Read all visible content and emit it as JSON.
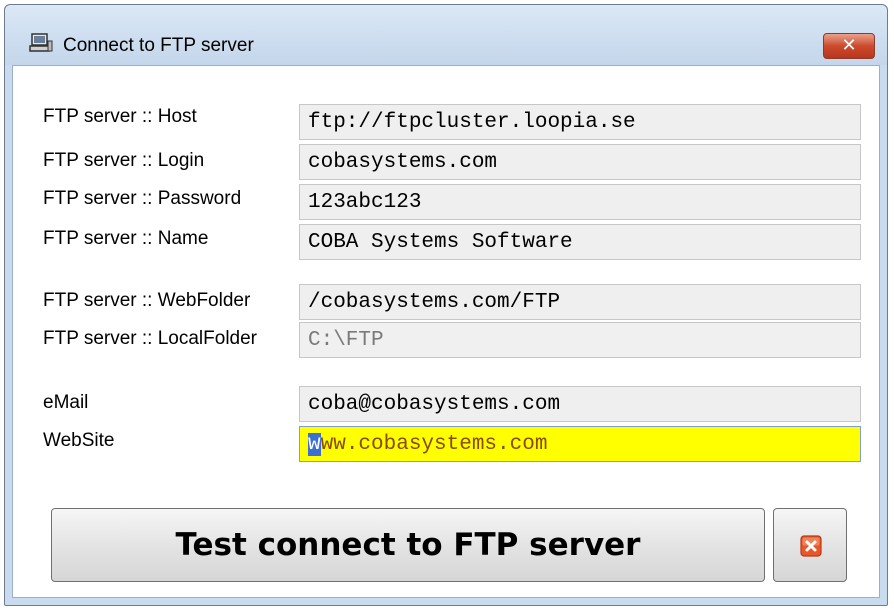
{
  "window": {
    "title": "Connect to FTP server",
    "close_glyph": "✕",
    "icon": "computer-icon"
  },
  "fields": [
    {
      "label": "FTP server :: Host",
      "value": "ftp://ftpcluster.loopia.se"
    },
    {
      "label": "FTP server :: Login",
      "value": "cobasystems.com"
    },
    {
      "label": "FTP server :: Password",
      "value": "123abc123"
    },
    {
      "label": "FTP server :: Name",
      "value": "COBA Systems Software"
    },
    {
      "label": "FTP server :: WebFolder",
      "value": "/cobasystems.com/FTP"
    },
    {
      "label": "FTP server :: LocalFolder",
      "value": "C:\\FTP",
      "disabled": true
    },
    {
      "label": "eMail",
      "value": "coba@cobasystems.com"
    },
    {
      "label": "WebSite",
      "value": "www.cobasystems.com",
      "focused": true,
      "value_selected": "w",
      "value_rest": "ww.cobasystems.com"
    }
  ],
  "buttons": {
    "test_label": "Test connect to FTP server",
    "cancel_icon": "close-icon"
  },
  "colors": {
    "focused_field_bg": "#ffff00",
    "field_bg": "#efefef",
    "cancel_icon": "#e8572b"
  }
}
